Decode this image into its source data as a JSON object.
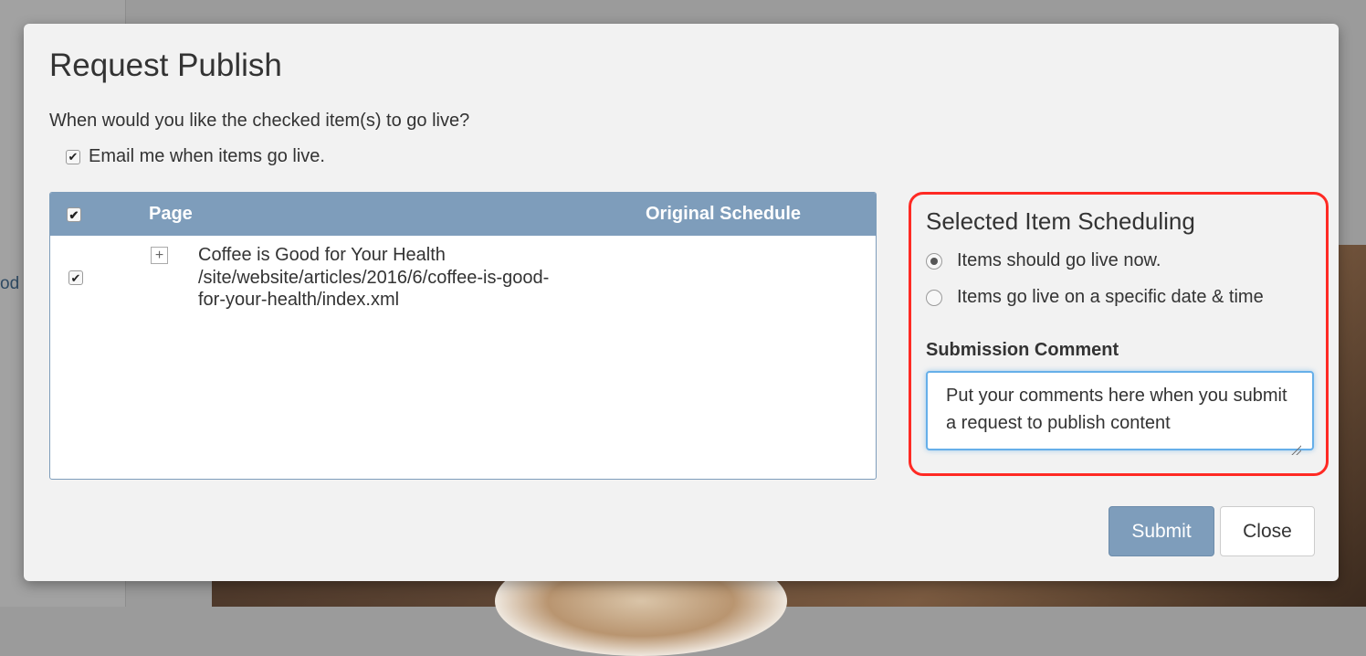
{
  "background": {
    "sidebar_partial_text": "od"
  },
  "modal": {
    "title": "Request Publish",
    "prompt": "When would you like the checked item(s) to go live?",
    "email_option": {
      "label": "Email me when items go live.",
      "checked": true
    }
  },
  "table": {
    "header_checked": true,
    "columns": [
      "Page",
      "Original Schedule"
    ],
    "rows": [
      {
        "checked": true,
        "title": "Coffee is Good for Your Health",
        "path_line1": "/site/website/articles/2016/6/coffee-is-good-",
        "path_line2": "for-your-health/index.xml",
        "original_schedule": ""
      }
    ]
  },
  "scheduling": {
    "title": "Selected Item Scheduling",
    "options": [
      {
        "label": "Items should go live now.",
        "selected": true
      },
      {
        "label": "Items go live on a specific date & time",
        "selected": false
      }
    ],
    "comment_label": "Submission Comment",
    "comment_value": "Put your comments here when you submit a request to publish content"
  },
  "buttons": {
    "submit": "Submit",
    "close": "Close"
  },
  "colors": {
    "accent": "#7e9dbb",
    "highlight_border": "#ff2a24",
    "focus": "#66afe9"
  }
}
